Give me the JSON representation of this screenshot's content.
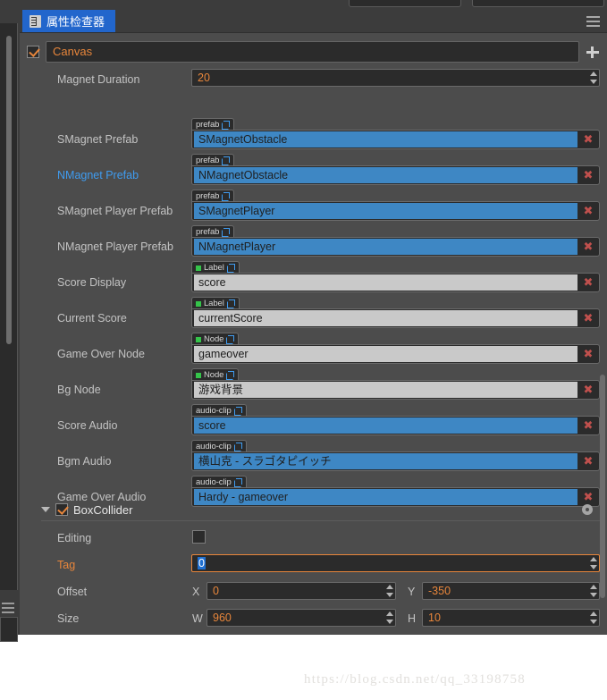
{
  "window": {
    "tab_label": "属性检查器",
    "tab_icon": "inspector-icon",
    "menu_icon": "hamburger-menu-icon"
  },
  "node": {
    "enabled": true,
    "name": "Canvas",
    "add_component_icon": "plus-icon"
  },
  "properties": [
    {
      "label": "Magnet Duration",
      "kind": "number",
      "value": "20"
    },
    {
      "label": "SMagnet Prefab",
      "kind": "asset",
      "badge": "prefab",
      "badge_dot": false,
      "value": "SMagnetObstacle",
      "value_style": "blue",
      "label_color": "normal"
    },
    {
      "label": "NMagnet Prefab",
      "kind": "asset",
      "badge": "prefab",
      "badge_dot": false,
      "value": "NMagnetObstacle",
      "value_style": "blue",
      "label_color": "link"
    },
    {
      "label": "SMagnet Player Prefab",
      "kind": "asset",
      "badge": "prefab",
      "badge_dot": false,
      "value": "SMagnetPlayer",
      "value_style": "blue",
      "label_color": "normal"
    },
    {
      "label": "NMagnet Player Prefab",
      "kind": "asset",
      "badge": "prefab",
      "badge_dot": false,
      "value": "NMagnetPlayer",
      "value_style": "blue",
      "label_color": "normal"
    },
    {
      "label": "Score Display",
      "kind": "asset",
      "badge": "Label",
      "badge_dot": true,
      "value": "score",
      "value_style": "gray",
      "label_color": "normal"
    },
    {
      "label": "Current Score",
      "kind": "asset",
      "badge": "Label",
      "badge_dot": true,
      "value": "currentScore",
      "value_style": "gray",
      "label_color": "normal"
    },
    {
      "label": "Game Over Node",
      "kind": "asset",
      "badge": "Node",
      "badge_dot": true,
      "value": "gameover",
      "value_style": "gray",
      "label_color": "normal"
    },
    {
      "label": "Bg Node",
      "kind": "asset",
      "badge": "Node",
      "badge_dot": true,
      "value": "游戏背景",
      "value_style": "gray",
      "label_color": "normal"
    },
    {
      "label": "Score Audio",
      "kind": "asset",
      "badge": "audio-clip",
      "badge_dot": false,
      "value": "score",
      "value_style": "blue",
      "label_color": "normal"
    },
    {
      "label": "Bgm Audio",
      "kind": "asset",
      "badge": "audio-clip",
      "badge_dot": false,
      "value": "横山克 - スラゴタピイッチ",
      "value_style": "blue",
      "label_color": "normal"
    },
    {
      "label": "Game Over Audio",
      "kind": "asset",
      "badge": "audio-clip",
      "badge_dot": false,
      "value": "Hardy - gameover",
      "value_style": "blue",
      "label_color": "normal"
    }
  ],
  "component": {
    "title": "BoxCollider",
    "enabled": true,
    "collapse_icon": "triangle-down-icon",
    "settings_icon": "gear-icon",
    "rows": {
      "editing": {
        "label": "Editing",
        "checked": false
      },
      "tag": {
        "label": "Tag",
        "value": "0",
        "focused": true,
        "selected": true
      },
      "offset": {
        "label": "Offset",
        "x_axis": "X",
        "x": "0",
        "y_axis": "Y",
        "y": "-350"
      },
      "size": {
        "label": "Size",
        "w_axis": "W",
        "w": "960",
        "h_axis": "H",
        "h": "10"
      }
    }
  },
  "delete_icon_glyph": "✖",
  "watermark": "https://blog.csdn.net/qq_33198758",
  "colors": {
    "panel_bg": "#4c4c4c",
    "field_bg": "#2b2b2b",
    "accent_orange": "#e8863b",
    "tab_blue": "#2266cc",
    "asset_blue": "#3e87c4",
    "asset_gray": "#c9c9c9",
    "link_blue": "#3f9cf0",
    "delete_red": "#c0504d",
    "badge_green": "#35c44a"
  }
}
